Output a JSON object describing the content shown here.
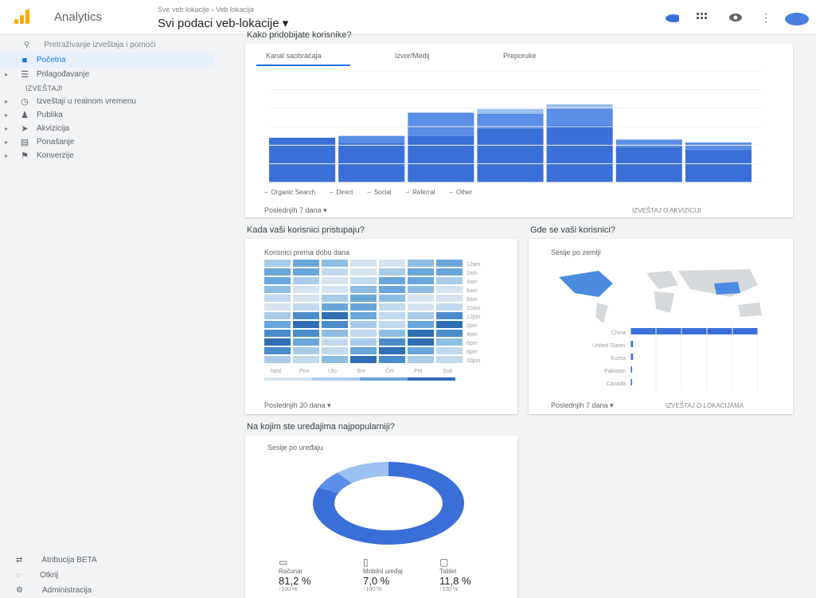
{
  "header": {
    "app_name": "Analytics",
    "breadcrumb": "Sve veb lokacije › Veb lokacija",
    "view": "Svi podaci veb-lokacije ▾",
    "icons": [
      "cloud-icon",
      "apps-icon",
      "view-icon",
      "more-icon",
      "account-icon"
    ]
  },
  "sidebar": {
    "search": "Pretraživanje izveštaja i pomoći",
    "items": [
      {
        "label": "Početna",
        "icon": "home-icon",
        "active": true
      },
      {
        "label": "Prilagođavanje",
        "icon": "customization-icon",
        "active": false
      }
    ],
    "section": "IZVEŠTAJI",
    "report_items": [
      {
        "label": "Izveštaji u realnom vremenu",
        "icon": "realtime-icon"
      },
      {
        "label": "Publika",
        "icon": "audience-icon"
      },
      {
        "label": "Akvizicija",
        "icon": "acquisition-icon"
      },
      {
        "label": "Ponašanje",
        "icon": "behavior-icon"
      },
      {
        "label": "Konverzije",
        "icon": "conversions-icon"
      }
    ],
    "bottom": [
      {
        "label": "Atribucija BETA",
        "icon": "attribution-icon"
      },
      {
        "label": "Otkrij",
        "icon": "discover-icon"
      },
      {
        "label": "Administracija",
        "icon": "admin-icon"
      }
    ]
  },
  "card_sources": {
    "question": "Kako pridobijate korisnike?",
    "tabs": [
      "Kanal saobraćaja",
      "Izvor/Medij",
      "Preporuke"
    ],
    "legend": [
      "Organic Search",
      "Direct",
      "Social",
      "Referral",
      "Other"
    ],
    "footer": "Poslednjih 7 dana ▾",
    "footer_link": "IZVEŠTAJ O AKVIZICIJI"
  },
  "card_time": {
    "question": "Kada vaši korisnici pristupaju?",
    "subtitle": "Korisnici prema dobu dana",
    "footer": "Poslednjih 30 dana ▾",
    "hours": [
      "12am",
      "2am",
      "4am",
      "6am",
      "8am",
      "10am",
      "12pm",
      "2pm",
      "4pm",
      "6pm",
      "8pm",
      "10pm"
    ],
    "days": [
      "Ned",
      "Pon",
      "Uto",
      "Sre",
      "Čet",
      "Pet",
      "Sub"
    ]
  },
  "card_geo": {
    "question": "Gde se vaši korisnici?",
    "subtitle": "Sesije po zemlji",
    "countries": [
      "China",
      "United States",
      "Korea",
      "Pakistan",
      "Canada"
    ],
    "footer": "Poslednjih 7 dana ▾",
    "footer_link": "IZVEŠTAJ O LOKACIJAMA"
  },
  "card_devices": {
    "question": "Na kojim ste uređajima najpopularniji?",
    "subtitle": "Sesije po uređaju",
    "devices": [
      {
        "name": "Računar",
        "pct": "81,2 %",
        "change": "↑100 %",
        "icon": "desktop-icon"
      },
      {
        "name": "Mobilni uređaj",
        "pct": "7,0 %",
        "change": "↑100 %",
        "icon": "mobile-icon"
      },
      {
        "name": "Tablet",
        "pct": "11,8 %",
        "change": "↑100 %",
        "icon": "tablet-icon"
      }
    ]
  },
  "colors": {
    "primary": "#3b6fd8",
    "mid": "#5b8ee6",
    "light": "#9cc0ef",
    "bg": "#f1f3f4"
  },
  "chart_data": [
    {
      "type": "bar",
      "title": "",
      "categories": [
        "",
        "",
        "",
        "",
        "",
        "",
        ""
      ],
      "series": [
        {
          "name": "Organic Search",
          "values": [
            4.8,
            4.2,
            5.0,
            5.8,
            6.2,
            3.8,
            3.5
          ]
        },
        {
          "name": "Direct",
          "values": [
            0,
            0.8,
            2.5,
            1.6,
            1.8,
            0.8,
            0.8
          ]
        },
        {
          "name": "Social",
          "values": [
            0,
            0,
            0,
            0.5,
            0.4,
            0,
            0
          ]
        }
      ],
      "ylim": [
        0,
        12
      ],
      "legend": "bottom"
    },
    {
      "type": "pie",
      "title": "",
      "categories": [
        "Računar",
        "Mobilni uređaj",
        "Tablet"
      ],
      "values": [
        81.2,
        7.0,
        11.8
      ]
    }
  ]
}
